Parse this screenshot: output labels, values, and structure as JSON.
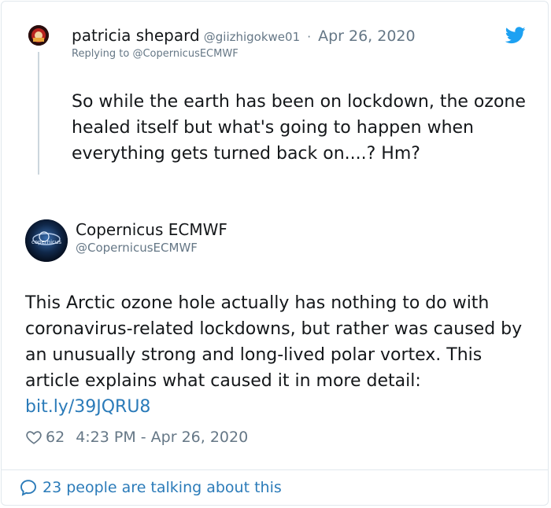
{
  "reply": {
    "name": "patricia shepard",
    "handle": "@giizhigokwe01",
    "separator": "·",
    "date": "Apr 26, 2020",
    "replying_prefix": "Replying to ",
    "replying_to": "@CopernicusECMWF",
    "text": "So while the earth has been on lockdown, the ozone healed itself but what's going to happen when everything gets turned back on....? Hm?"
  },
  "main": {
    "name": "Copernicus ECMWF",
    "handle": "@CopernicusECMWF",
    "avatar_label": "copernicus",
    "text_before_link": "This Arctic ozone hole actually has nothing to do with coronavirus-related lockdowns, but rather was caused by an unusually strong and long-lived polar vortex. This article explains what caused it in more detail: ",
    "link_text": "bit.ly/39JQRU8",
    "likes": "62",
    "timestamp": "4:23 PM - Apr 26, 2020"
  },
  "footer": {
    "talking": "23 people are talking about this"
  },
  "colors": {
    "twitter_blue": "#1da1f2",
    "link_blue": "#2b7bb9",
    "muted_gray": "#657786",
    "border": "#e1e8ed"
  },
  "icons": {
    "brand": "twitter-bird-icon",
    "like": "heart-icon",
    "conversation": "speech-bubble-icon"
  }
}
